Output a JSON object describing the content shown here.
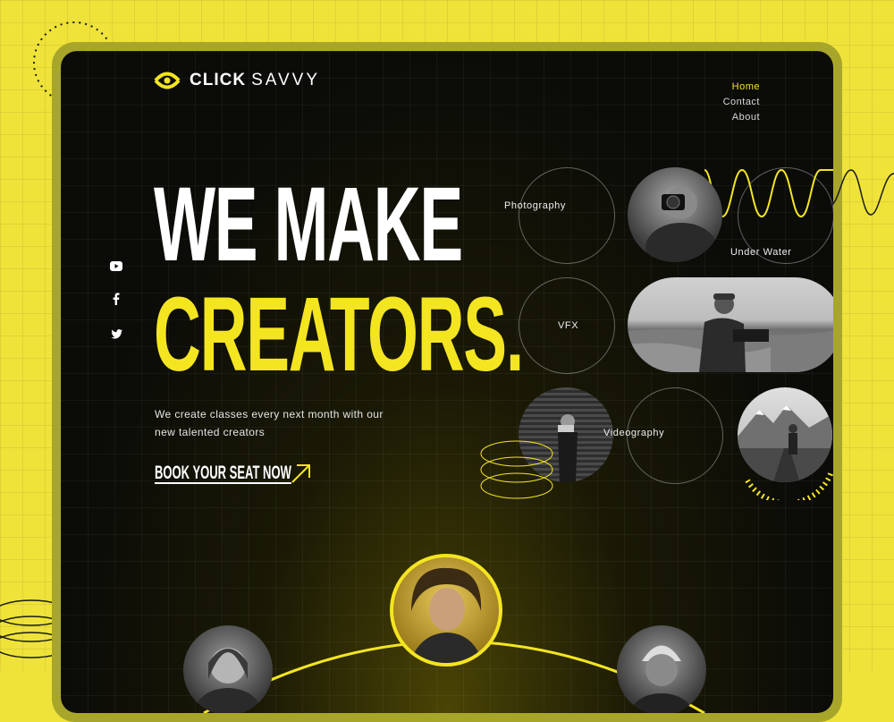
{
  "brand": {
    "name_bold": "CLICK",
    "name_light": "SAVVY"
  },
  "nav": {
    "items": [
      {
        "label": "Home",
        "active": true
      },
      {
        "label": "Contact",
        "active": false
      },
      {
        "label": "About",
        "active": false
      }
    ]
  },
  "hero": {
    "line1": "WE MAKE",
    "line2": "CREATORS.",
    "subtitle_line1": "We create classes every next month with our",
    "subtitle_line2": "new talented creators",
    "cta_label": "BOOK YOUR SEAT NOW"
  },
  "social": [
    {
      "icon": "youtube-icon"
    },
    {
      "icon": "facebook-icon"
    },
    {
      "icon": "twitter-icon"
    }
  ],
  "categories": {
    "photography": "Photography",
    "under_water": "Under Water",
    "vfx": "VFX",
    "videography": "Videography"
  },
  "colors": {
    "accent": "#f4e521",
    "background": "#efe33a",
    "screen": "#0b0b08"
  }
}
